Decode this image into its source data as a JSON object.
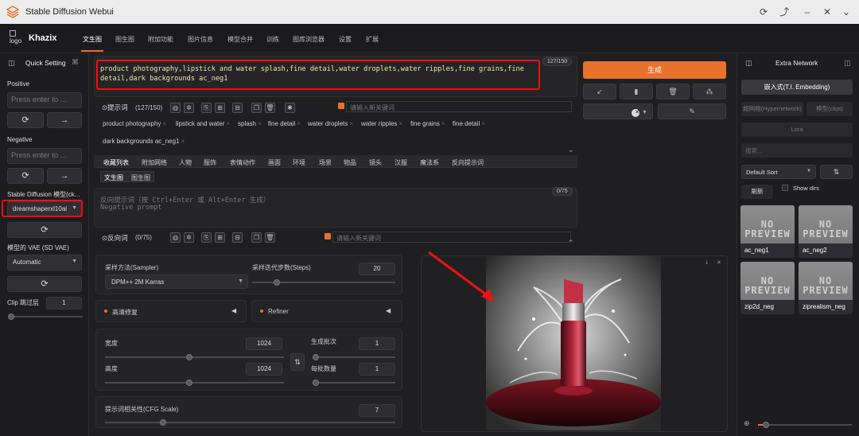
{
  "app": {
    "title": "Stable Diffusion Webui",
    "brand": "Khazix",
    "logo_text": "logo"
  },
  "nav": {
    "tabs": [
      "文生图",
      "图生图",
      "附加功能",
      "图片信息",
      "模型合并",
      "训练",
      "图库浏览器",
      "设置",
      "扩展"
    ]
  },
  "sidebar": {
    "title": "Quick Setting",
    "positive_label": "Positive",
    "positive_placeholder": "Press enter to ...",
    "negative_label": "Negative",
    "negative_placeholder": "Press enter to ...",
    "model_label": "Stable Diffusion 模型(ck...",
    "model_value": "dreamshaperxl10al",
    "vae_label": "模型的 VAE (SD VAE)",
    "vae_value": "Automatic",
    "clip_label": "Clip 跳过层",
    "clip_value": "1"
  },
  "prompt": {
    "text": "product photography,lipstick and water splash,fine detail,water droplets,water ripples,fine grains,fine detail,dark backgrounds ac_neg1",
    "counter": "127/150",
    "section_label": "提示词",
    "section_count": "(127/150)",
    "new_keyword_placeholder": "请输入新关键词",
    "tags": [
      "product photography",
      "lipstick and water",
      "splash",
      "fine detail",
      "water droplets",
      "water ripples",
      "fine grains",
      "fine detail",
      "dark backgrounds ac_neg1"
    ]
  },
  "categories": [
    "收藏列表",
    "附加网络",
    "人物",
    "服饰",
    "表情动作",
    "画面",
    "环境",
    "场景",
    "物品",
    "镜头",
    "汉服",
    "魔法系",
    "反向提示词"
  ],
  "subcats": [
    "文生图",
    "图生图"
  ],
  "negative": {
    "placeholder_line1": "反向提示词（按 Ctrl+Enter 或 Alt+Enter 生成）",
    "placeholder_line2": "Negative prompt",
    "counter": "0/75",
    "section_label": "反向词",
    "section_count": "(0/75)",
    "new_keyword_placeholder": "请输入新关键词"
  },
  "params": {
    "sampler_label": "采样方法(Sampler)",
    "sampler_value": "DPM++ 2M Karras",
    "steps_label": "采样迭代步数(Steps)",
    "steps_value": "20",
    "hires_label": "高清修复",
    "refiner_label": "Refiner",
    "width_label": "宽度",
    "width_value": "1024",
    "height_label": "高度",
    "height_value": "1024",
    "batch_count_label": "生成批次",
    "batch_count_value": "1",
    "batch_size_label": "每批数量",
    "batch_size_value": "1",
    "cfg_label": "提示词相关性(CFG Scale)",
    "cfg_value": "7",
    "steps_fraction": 0.17,
    "width_fraction": 0.47,
    "height_fraction": 0.47,
    "batch_count_fraction": 0.0,
    "batch_size_fraction": 0.0,
    "cfg_fraction": 0.2
  },
  "generate": {
    "label": "生成"
  },
  "extra": {
    "title": "Extra Network",
    "tabs": [
      "嵌入式(T.I. Embedding)",
      "超网络(Hypernetwork)",
      "模型(ckpt)",
      "Lora"
    ],
    "search_placeholder": "搜索...",
    "sort_value": "Default Sort",
    "refresh_label": "刷新",
    "show_dirs_label": "Show dirs",
    "no_preview": "NO PREVIEW",
    "items": [
      "ac_neg1",
      "ac_neg2",
      "zip2d_neg",
      "ziprealism_neg"
    ]
  },
  "colors": {
    "accent": "#e8722c",
    "highlight": "#e11111",
    "prompt_text": "#f0e6a8"
  }
}
